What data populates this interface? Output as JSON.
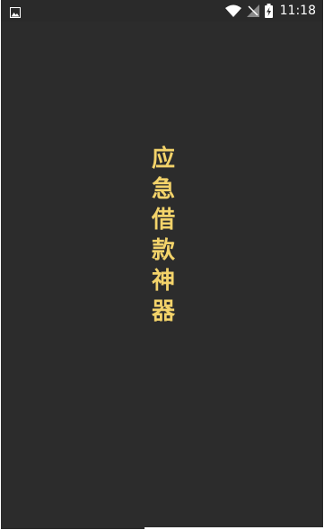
{
  "status_bar": {
    "time": "11:18",
    "icons": [
      "gallery-icon",
      "wifi-icon",
      "no-signal-icon",
      "battery-charging-icon"
    ]
  },
  "splash": {
    "title_chars": [
      "应",
      "急",
      "借",
      "款",
      "神",
      "器"
    ],
    "title_color": "#f3d36a",
    "background_color": "#2c2c2c"
  }
}
